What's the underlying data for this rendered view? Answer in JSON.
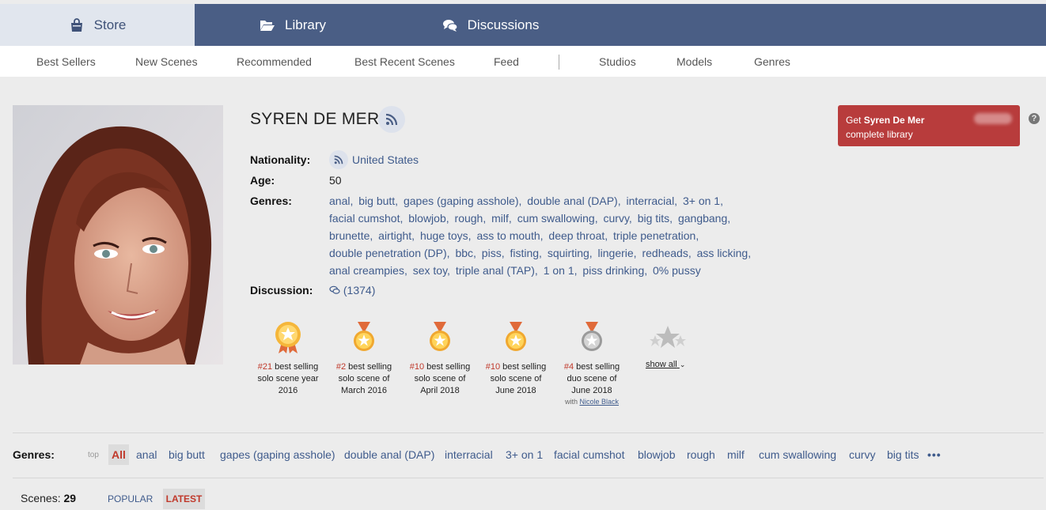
{
  "tabs": [
    {
      "label": "Store",
      "icon": "shopping-bag-icon"
    },
    {
      "label": "Library",
      "icon": "folder-open-icon"
    },
    {
      "label": "Discussions",
      "icon": "comments-icon"
    }
  ],
  "subnav": [
    "Best Sellers",
    "New Scenes",
    "Recommended",
    "Best Recent Scenes",
    "Feed",
    "Studios",
    "Models",
    "Genres"
  ],
  "model": {
    "name": "SYREN DE MER",
    "nationality_label": "Nationality:",
    "nationality": "United States",
    "age_label": "Age:",
    "age": "50",
    "genres_label": "Genres:",
    "genre_lines": [
      [
        "anal,",
        "big butt,",
        "gapes (gaping asshole),",
        "double anal (DAP),",
        "interracial,",
        "3+ on 1,"
      ],
      [
        "facial cumshot,",
        "blowjob,",
        "rough,",
        "milf,",
        "cum swallowing,",
        "curvy,",
        "big tits,",
        "gangbang,"
      ],
      [
        "brunette,",
        "airtight,",
        "huge toys,",
        "ass to mouth,",
        "deep throat,",
        "triple penetration,"
      ],
      [
        "double penetration (DP),",
        "bbc,",
        "piss,",
        "fisting,",
        "squirting,",
        "lingerie,",
        "redheads,",
        "ass licking,"
      ],
      [
        "anal creampies,",
        "sex toy,",
        "triple anal (TAP),",
        "1 on 1,",
        "piss drinking,",
        "0% pussy"
      ]
    ],
    "discussion_label": "Discussion:",
    "discussion_count": "(1374)"
  },
  "awards": [
    {
      "rank": "#21",
      "text1": " best selling",
      "text2": "solo scene year",
      "text3": "2016",
      "medal": "gold-rosette"
    },
    {
      "rank": "#2",
      "text1": " best selling",
      "text2": "solo scene of",
      "text3": "March 2016",
      "medal": "gold"
    },
    {
      "rank": "#10",
      "text1": " best selling",
      "text2": "solo scene of",
      "text3": "April 2018",
      "medal": "gold"
    },
    {
      "rank": "#10",
      "text1": " best selling",
      "text2": "solo scene of",
      "text3": "June 2018",
      "medal": "gold"
    },
    {
      "rank": "#4",
      "text1": " best selling",
      "text2": "duo scene of",
      "text3": "June 2018",
      "medal": "silver",
      "with_label": "with ",
      "with_name": "Nicole Black"
    }
  ],
  "show_all": "show all",
  "cta": {
    "get": "Get ",
    "name": "Syren De Mer",
    "line2": "complete library",
    "help": "?"
  },
  "genre_bar": {
    "label": "Genres:",
    "top": "top",
    "all": "All",
    "items": [
      "anal",
      "big butt",
      "gapes (gaping asshole)",
      "double anal (DAP)",
      "interracial",
      "3+ on 1",
      "facial cumshot",
      "blowjob",
      "rough",
      "milf",
      "cum swallowing",
      "curvy",
      "big tits"
    ],
    "more": "•••"
  },
  "scenes": {
    "label": "Scenes: ",
    "count": "29",
    "popular": "POPULAR",
    "latest": "LATEST"
  },
  "colors": {
    "nav": "#4a5e85",
    "accent_red": "#b83c3c",
    "link": "#3f5b8c",
    "rank_red": "#c0392b"
  }
}
